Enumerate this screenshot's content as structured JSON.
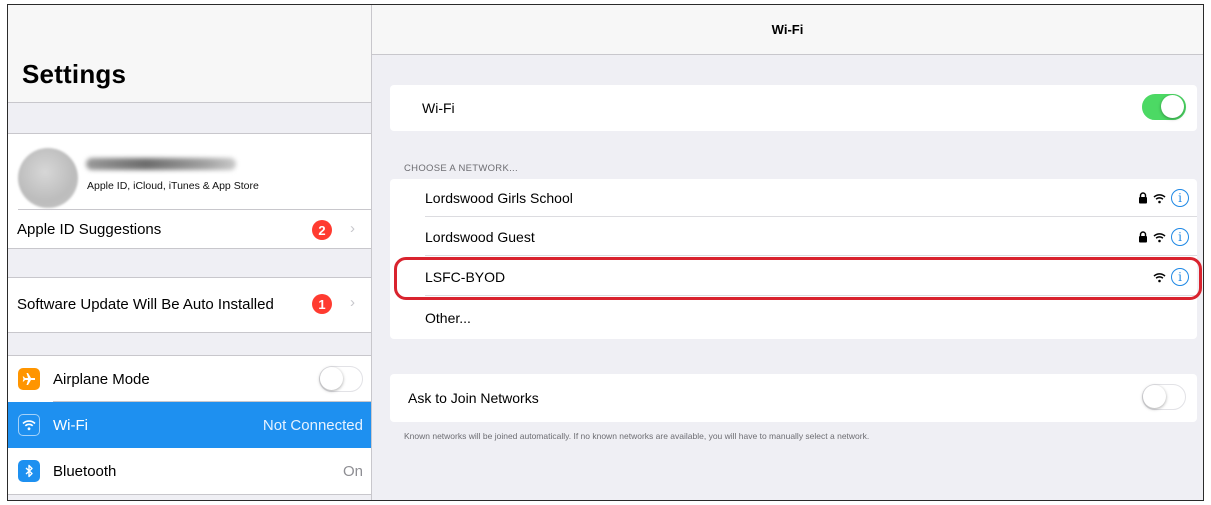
{
  "left": {
    "title": "Settings",
    "account": {
      "subtitle": "Apple ID, iCloud, iTunes & App Store"
    },
    "suggestions": {
      "label": "Apple ID Suggestions",
      "badge": "2"
    },
    "update": {
      "label": "Software Update Will Be Auto Installed",
      "badge": "1"
    },
    "items": [
      {
        "label": "Airplane Mode",
        "value": "",
        "icon": "airplane-icon",
        "color": "#ff9500"
      },
      {
        "label": "Wi-Fi",
        "value": "Not Connected",
        "icon": "wifi-icon",
        "color": "#1e90f0"
      },
      {
        "label": "Bluetooth",
        "value": "On",
        "icon": "bluetooth-icon",
        "color": "#1e90f0"
      }
    ]
  },
  "right": {
    "title": "Wi-Fi",
    "wifi_toggle_label": "Wi-Fi",
    "wifi_on": true,
    "section_label": "CHOOSE A NETWORK...",
    "networks": [
      {
        "name": "Lordswood Girls School",
        "secured": true
      },
      {
        "name": "Lordswood Guest",
        "secured": true
      },
      {
        "name": "LSFC-BYOD",
        "secured": false
      },
      {
        "name": "Other..."
      }
    ],
    "ask_label": "Ask to Join Networks",
    "ask_on": false,
    "footnote": "Known networks will be joined automatically. If no known networks are available, you will have to manually select a network."
  },
  "colors": {
    "accent": "#1e90f0",
    "toggle_on": "#4cd964",
    "badge": "#ff3b30",
    "highlight": "#d9232e",
    "info": "#1e88e5"
  }
}
